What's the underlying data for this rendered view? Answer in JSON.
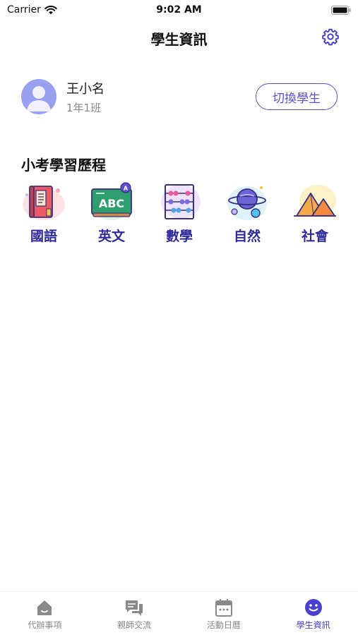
{
  "status_bar": {
    "carrier": "Carrier",
    "time": "9:02 AM"
  },
  "nav": {
    "title": "學生資訊",
    "settings_icon": "gear-icon"
  },
  "student": {
    "name": "王小名",
    "class": "1年1班",
    "switch_label": "切換學生"
  },
  "section": {
    "title": "小考學習歷程",
    "subjects": [
      {
        "label": "國語",
        "icon": "book-icon"
      },
      {
        "label": "英文",
        "icon": "chalkboard-abc-icon"
      },
      {
        "label": "數學",
        "icon": "abacus-icon"
      },
      {
        "label": "自然",
        "icon": "planet-icon"
      },
      {
        "label": "社會",
        "icon": "pyramid-icon"
      }
    ]
  },
  "tabs": [
    {
      "label": "代辦事項",
      "icon": "home-icon",
      "active": false
    },
    {
      "label": "親師交流",
      "icon": "chat-icon",
      "active": false
    },
    {
      "label": "活動日曆",
      "icon": "calendar-icon",
      "active": false
    },
    {
      "label": "學生資訊",
      "icon": "smiley-icon",
      "active": true
    }
  ],
  "colors": {
    "accent": "#4a3fd0",
    "subject_label": "#2e2a9a",
    "inactive_tab": "#888888"
  }
}
